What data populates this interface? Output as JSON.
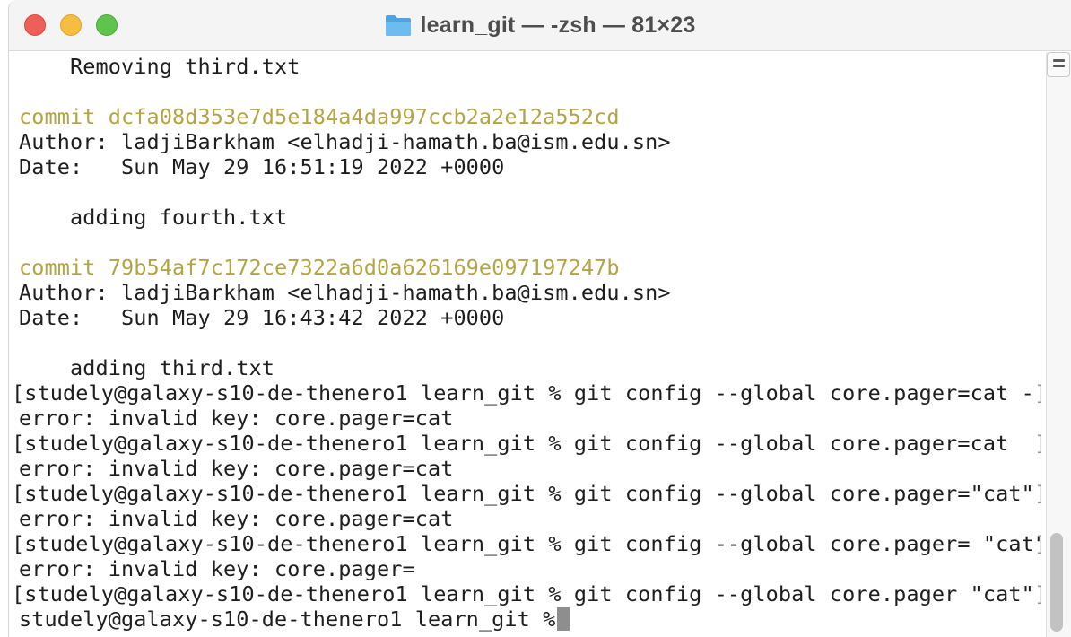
{
  "window": {
    "title": "learn_git — -zsh — 81×23",
    "title_icon": "folder-icon",
    "controls": [
      "close",
      "minimize",
      "zoom"
    ],
    "colors": {
      "close": "#ee5f57",
      "minimize": "#f6bd41",
      "zoom": "#5fc44c",
      "commit_hash": "#b3a545"
    }
  },
  "terminal": {
    "lines": [
      {
        "kind": "output",
        "text": "    Removing third.txt"
      },
      {
        "kind": "blank",
        "text": ""
      },
      {
        "kind": "commit",
        "text": "commit dcfa08d353e7d5e184a4da997ccb2a2e12a552cd"
      },
      {
        "kind": "output",
        "text": "Author: ladjiBarkham <elhadji-hamath.ba@ism.edu.sn>"
      },
      {
        "kind": "output",
        "text": "Date:   Sun May 29 16:51:19 2022 +0000"
      },
      {
        "kind": "blank",
        "text": ""
      },
      {
        "kind": "output",
        "text": "    adding fourth.txt"
      },
      {
        "kind": "blank",
        "text": ""
      },
      {
        "kind": "commit",
        "text": "commit 79b54af7c172ce7322a6d0a626169e097197247b"
      },
      {
        "kind": "output",
        "text": "Author: ladjiBarkham <elhadji-hamath.ba@ism.edu.sn>"
      },
      {
        "kind": "output",
        "text": "Date:   Sun May 29 16:43:42 2022 +0000"
      },
      {
        "kind": "blank",
        "text": ""
      },
      {
        "kind": "output",
        "text": "    adding third.txt"
      },
      {
        "kind": "prompt",
        "text": "[studely@galaxy-s10-de-thenero1 learn_git % git config --global core.pager=cat -"
      },
      {
        "kind": "output",
        "text": "error: invalid key: core.pager=cat"
      },
      {
        "kind": "prompt",
        "text": "[studely@galaxy-s10-de-thenero1 learn_git % git config --global core.pager=cat"
      },
      {
        "kind": "output",
        "text": "error: invalid key: core.pager=cat"
      },
      {
        "kind": "prompt",
        "text": "[studely@galaxy-s10-de-thenero1 learn_git % git config --global core.pager=\"cat\""
      },
      {
        "kind": "output",
        "text": "error: invalid key: core.pager=cat"
      },
      {
        "kind": "prompt",
        "text": "[studely@galaxy-s10-de-thenero1 learn_git % git config --global core.pager= \"cat\""
      },
      {
        "kind": "output",
        "text": "error: invalid key: core.pager="
      },
      {
        "kind": "prompt",
        "text": "[studely@galaxy-s10-de-thenero1 learn_git % git config --global core.pager \"cat\""
      },
      {
        "kind": "current-prompt",
        "text": "studely@galaxy-s10-de-thenero1 learn_git % "
      }
    ],
    "right_bracket": "]"
  }
}
